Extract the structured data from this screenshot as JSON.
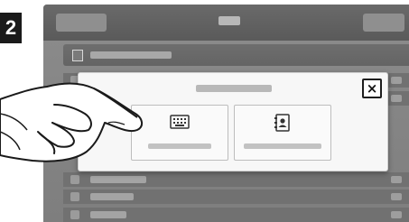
{
  "step": {
    "number": "2"
  },
  "background": {
    "top_bar": {
      "items": [
        "user-button",
        "screen-title",
        "right-button"
      ]
    },
    "sub_bar": {
      "icon": "document-icon"
    },
    "rows": [
      "row-1",
      "row-2",
      "row-3",
      "row-4",
      "row-5",
      "row-6"
    ]
  },
  "dialog": {
    "close_label": "×",
    "options": [
      {
        "icon": "keyboard-icon"
      },
      {
        "icon": "address-book-icon"
      }
    ]
  },
  "overlay": {
    "icon": "pointing-hand-illustration"
  }
}
